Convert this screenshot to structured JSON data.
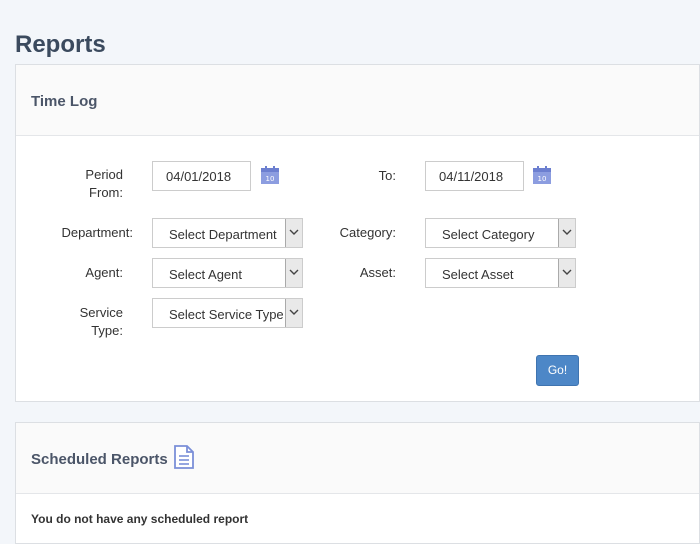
{
  "page": {
    "title": "Reports"
  },
  "time_log": {
    "title": "Time Log",
    "period_from_label_line1": "Period",
    "period_from_label_line2": "From:",
    "period_from_value": "04/01/2018",
    "to_label": "To:",
    "to_value": "04/11/2018",
    "calendar_icon_day": "10",
    "department_label": "Department:",
    "department_value": "Select Department",
    "category_label": "Category:",
    "category_value": "Select Category",
    "agent_label": "Agent:",
    "agent_value": "Select Agent",
    "asset_label": "Asset:",
    "asset_value": "Select Asset",
    "service_type_label_line1": "Service",
    "service_type_label_line2": "Type:",
    "service_type_value": "Select Service Type",
    "go_label": "Go!"
  },
  "scheduled_reports": {
    "title": "Scheduled Reports",
    "icon": "document-icon",
    "empty_message": "You do not have any scheduled report"
  },
  "colors": {
    "accent": "#4d87c7",
    "icon": "#7b8fd8",
    "title": "#3b4a5e"
  }
}
